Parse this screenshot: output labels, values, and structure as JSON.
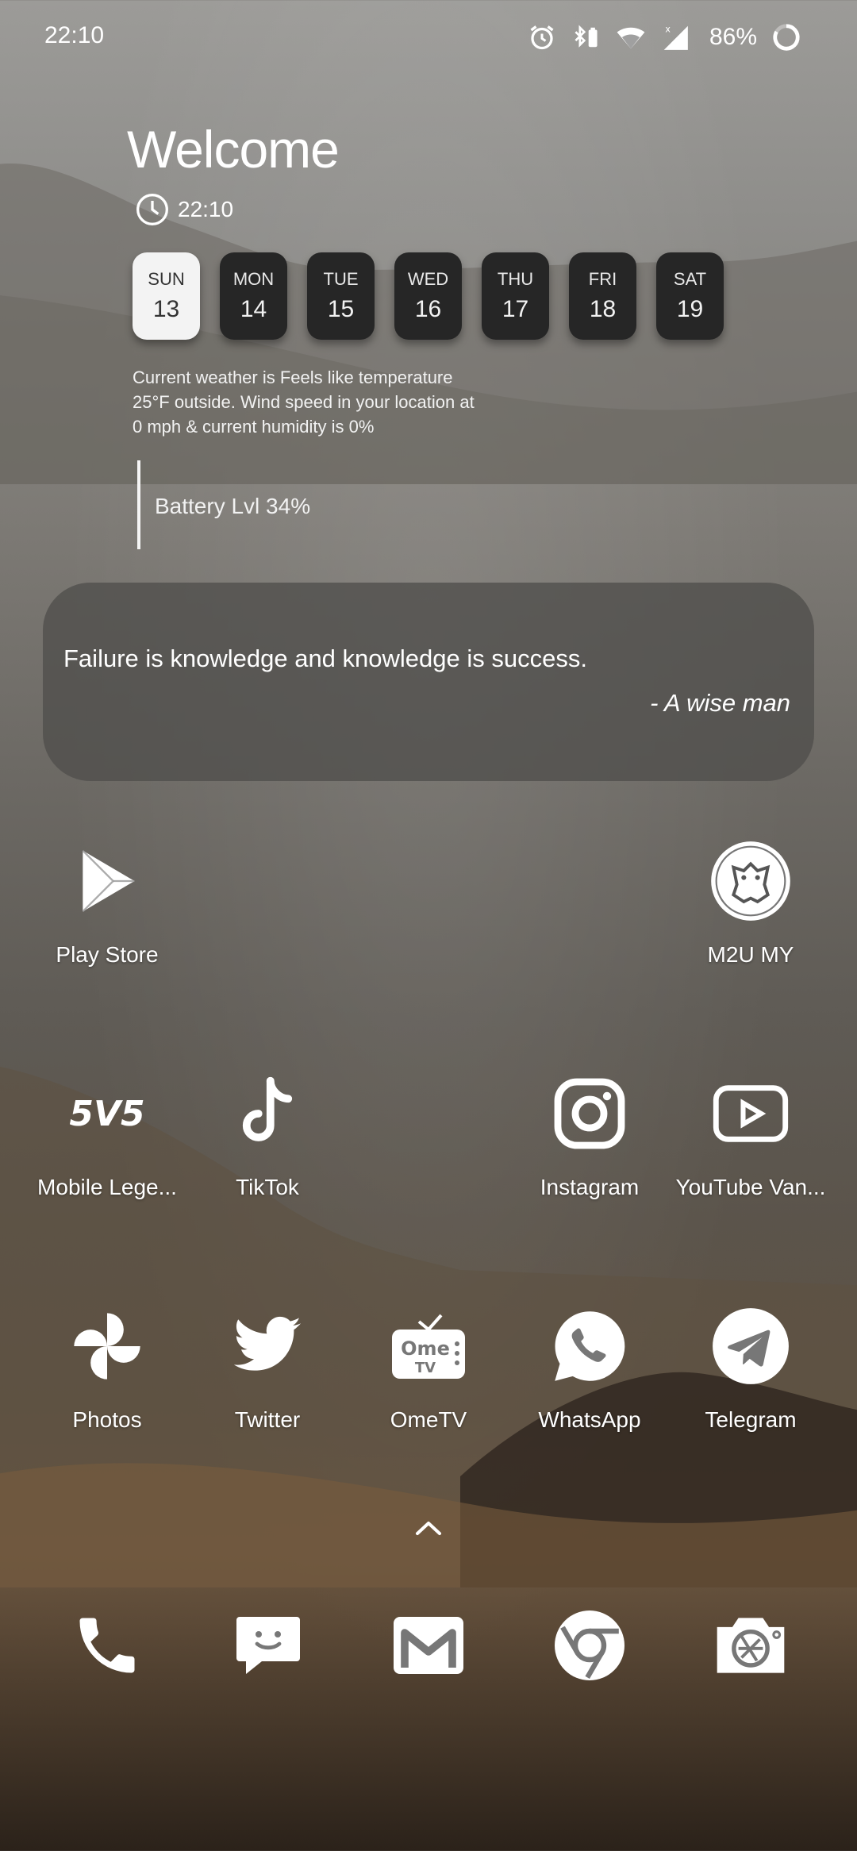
{
  "status_bar": {
    "time": "22:10",
    "battery_percent": "86%",
    "icons": [
      "alarm-icon",
      "bluetooth-battery-icon",
      "wifi-icon",
      "cellular-no-data-icon",
      "battery-ring-icon"
    ]
  },
  "widget": {
    "welcome": "Welcome",
    "clock_time": "22:10",
    "days": [
      {
        "name": "SUN",
        "date": "13",
        "active": true
      },
      {
        "name": "MON",
        "date": "14",
        "active": false
      },
      {
        "name": "TUE",
        "date": "15",
        "active": false
      },
      {
        "name": "WED",
        "date": "16",
        "active": false
      },
      {
        "name": "THU",
        "date": "17",
        "active": false
      },
      {
        "name": "FRI",
        "date": "18",
        "active": false
      },
      {
        "name": "SAT",
        "date": "19",
        "active": false
      }
    ],
    "weather_line1": "Current weather is  Feels like temperature",
    "weather_line2": "25°F outside. Wind speed in your location at",
    "weather_line3": "0 mph & current humidity is 0%",
    "battery": "Battery Lvl 34%"
  },
  "quote": {
    "text": "Failure is knowledge and knowledge is success.",
    "author": "- A wise man"
  },
  "apps": {
    "row1": [
      {
        "label": "Play Store",
        "icon": "play-store-icon"
      },
      {
        "label": "M2U MY",
        "icon": "maybank-tiger-icon"
      }
    ],
    "row2": [
      {
        "label": "Mobile Lege...",
        "icon": "mobile-legends-icon"
      },
      {
        "label": "TikTok",
        "icon": "tiktok-icon"
      },
      {
        "label": "Instagram",
        "icon": "instagram-icon"
      },
      {
        "label": "YouTube Van...",
        "icon": "youtube-icon"
      }
    ],
    "row3": [
      {
        "label": "Photos",
        "icon": "photos-pinwheel-icon"
      },
      {
        "label": "Twitter",
        "icon": "twitter-bird-icon"
      },
      {
        "label": "OmeTV",
        "icon": "ometv-icon"
      },
      {
        "label": "WhatsApp",
        "icon": "whatsapp-icon"
      },
      {
        "label": "Telegram",
        "icon": "telegram-icon"
      }
    ]
  },
  "logo_texts": {
    "mobile_legends": "5V5",
    "ometv_top": "Ome",
    "ometv_bottom": "TV"
  },
  "dock": [
    "phone-icon",
    "messages-icon",
    "gmail-icon",
    "chrome-icon",
    "camera-icon"
  ]
}
